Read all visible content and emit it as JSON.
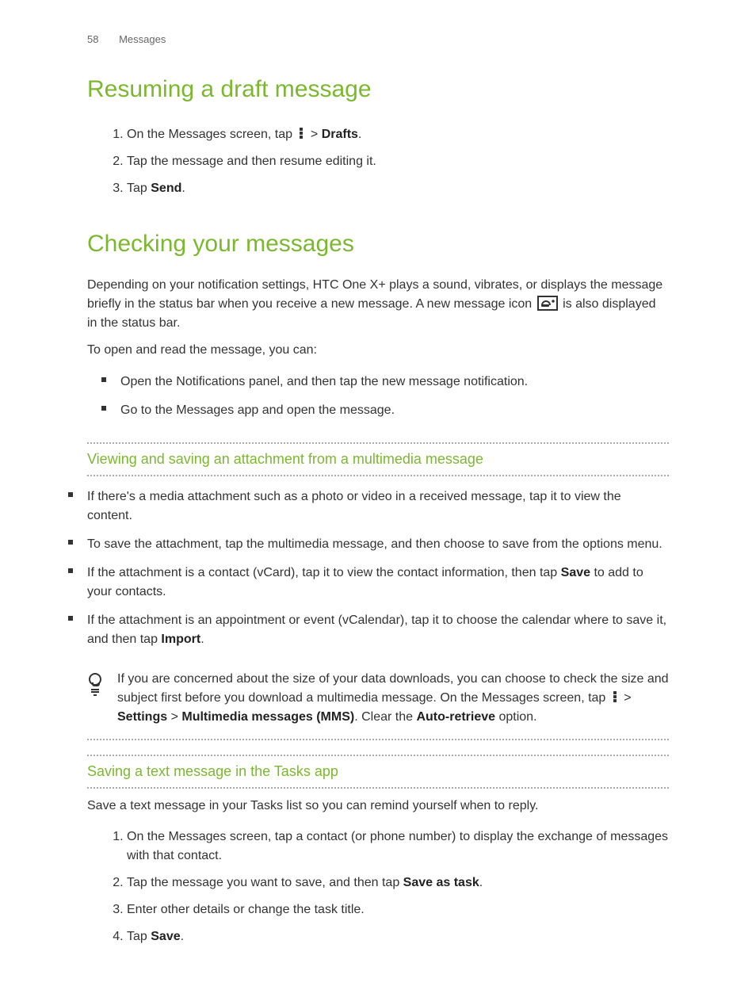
{
  "header": {
    "page_number": "58",
    "section": "Messages"
  },
  "section1": {
    "title": "Resuming a draft message",
    "steps": [
      {
        "pre": "On the Messages screen, tap ",
        "post": " > ",
        "bold": "Drafts",
        "suffix": "."
      },
      {
        "text": "Tap the message and then resume editing it."
      },
      {
        "pre": "Tap ",
        "bold": "Send",
        "suffix": "."
      }
    ]
  },
  "section2": {
    "title": "Checking your messages",
    "para1_a": "Depending on your notification settings, HTC One X+ plays a sound, vibrates, or displays the message briefly in the status bar when you receive a new message. A new message icon ",
    "para1_b": " is also displayed in the status bar.",
    "para2": "To open and read the message, you can:",
    "bullets": [
      "Open the Notifications panel, and then tap the new message notification.",
      "Go to the Messages app and open the message."
    ]
  },
  "subsection1": {
    "title": "Viewing and saving an attachment from a multimedia message",
    "bullets": [
      {
        "text": "If there's a media attachment such as a photo or video in a received message, tap it to view the content."
      },
      {
        "text": "To save the attachment, tap the multimedia message, and then choose to save from the options menu."
      },
      {
        "pre": "If the attachment is a contact (vCard), tap it to view the contact information, then tap ",
        "bold": "Save",
        "post": " to add to your contacts."
      },
      {
        "pre": "If the attachment is an appointment or event (vCalendar), tap it to choose the calendar where to save it, and then tap ",
        "bold": "Import",
        "post": "."
      }
    ]
  },
  "tip": {
    "text_a": "If you are concerned about the size of your data downloads, you can choose to check the size and subject first before you download a multimedia message. On the Messages screen, tap ",
    "text_b": " > ",
    "bold_b": "Settings",
    "text_c": " > ",
    "bold_c": "Multimedia messages (MMS)",
    "text_d": ". Clear the ",
    "bold_d": "Auto-retrieve",
    "text_e": " option."
  },
  "subsection2": {
    "title": "Saving a text message in the Tasks app",
    "para": "Save a text message in your Tasks list so you can remind yourself when to reply.",
    "steps": [
      {
        "text": "On the Messages screen, tap a contact (or phone number) to display the exchange of messages with that contact."
      },
      {
        "pre": "Tap the message you want to save, and then tap ",
        "bold": "Save as task",
        "suffix": "."
      },
      {
        "text": "Enter other details or change the task title."
      },
      {
        "pre": "Tap ",
        "bold": "Save",
        "suffix": "."
      }
    ]
  }
}
